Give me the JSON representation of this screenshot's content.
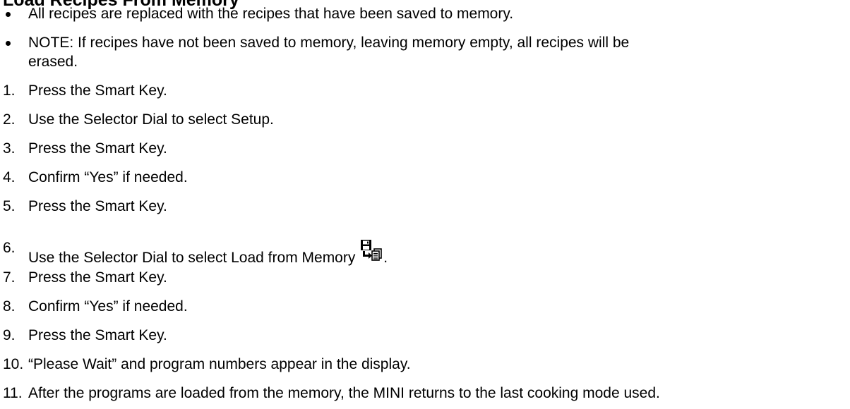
{
  "heading": "Load Recipes From Memory",
  "bullets": [
    "All recipes are replaced with the recipes that have been saved to memory.",
    "NOTE: If recipes have not been saved to memory, leaving memory empty, all recipes will be",
    "erased."
  ],
  "steps": [
    {
      "num": "1.",
      "text": "Press the Smart Key."
    },
    {
      "num": "2.",
      "text": "Use the Selector Dial to select Setup."
    },
    {
      "num": "3.",
      "text": "Press the Smart Key."
    },
    {
      "num": "4.",
      "text": "Confirm “Yes” if needed."
    },
    {
      "num": "5.",
      "text": "Press the Smart Key."
    },
    {
      "num": "6.",
      "text": "Use the Selector Dial to select Load from Memory",
      "suffix": "."
    },
    {
      "num": "7.",
      "text": "Press the Smart Key."
    },
    {
      "num": "8.",
      "text": "Confirm “Yes” if needed."
    },
    {
      "num": "9.",
      "text": "Press the Smart Key."
    },
    {
      "num": "10.",
      "text": "“Please Wait” and program numbers appear in the display."
    },
    {
      "num": "11.",
      "text": "After the programs are loaded from the memory, the MINI returns to the last cooking mode used."
    }
  ],
  "icons": {
    "load_from_memory": "load-from-memory-icon"
  }
}
